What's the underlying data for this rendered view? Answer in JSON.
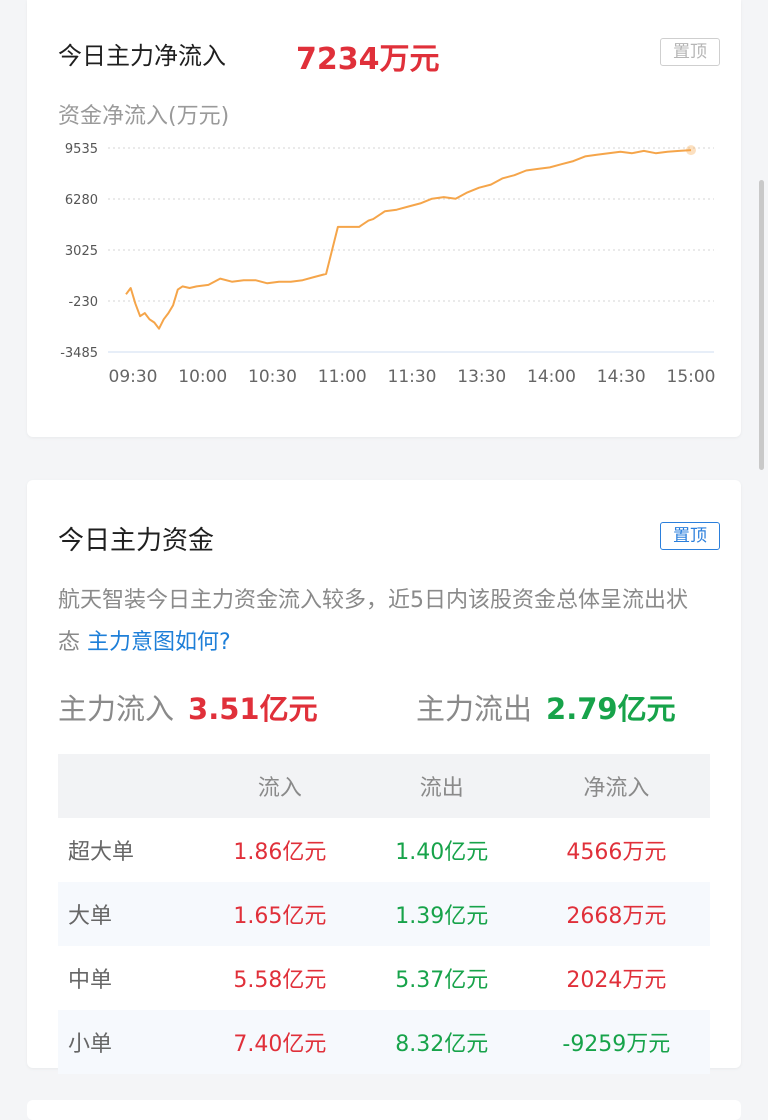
{
  "flow_card": {
    "title": "今日主力净流入",
    "value": "7234万元",
    "pin_label": "置顶",
    "chart_unit_label": "资金净流入(万元)"
  },
  "chart_data": {
    "type": "line",
    "ylim": [
      -3485,
      9535
    ],
    "yticks": [
      "9535",
      "6280",
      "3025",
      "-230",
      "-3485"
    ],
    "xticks": [
      "09:30",
      "10:00",
      "10:30",
      "11:00",
      "11:30",
      "13:30",
      "14:00",
      "14:30",
      "15:00"
    ],
    "grid": true,
    "line_color": "#f5a54a",
    "series": [
      {
        "x": [
          0,
          2,
          4,
          6,
          8,
          10,
          12,
          14,
          16,
          18,
          20,
          22,
          24,
          27,
          30,
          35,
          40,
          45,
          50,
          55,
          60,
          65,
          70,
          75,
          80,
          85,
          90,
          95,
          99,
          100,
          103,
          105,
          110,
          115,
          120,
          125,
          130,
          135,
          140,
          145,
          150,
          155,
          160,
          165,
          170,
          175,
          180,
          185,
          190,
          195,
          200,
          205,
          210,
          215,
          220,
          225,
          230,
          235,
          240
        ],
        "y": [
          200,
          600,
          -400,
          -1200,
          -1000,
          -1400,
          -1600,
          -2000,
          -1400,
          -1000,
          -500,
          500,
          700,
          600,
          700,
          800,
          1200,
          1000,
          1100,
          1100,
          900,
          1000,
          1000,
          1100,
          1300,
          1500,
          4500,
          4500,
          4500,
          4600,
          4900,
          5000,
          5500,
          5600,
          5800,
          6000,
          6300,
          6400,
          6300,
          6700,
          7000,
          7200,
          7600,
          7800,
          8100,
          8200,
          8300,
          8500,
          8700,
          9000,
          9100,
          9200,
          9300,
          9200,
          9350,
          9200,
          9300,
          9350,
          9400
        ]
      }
    ]
  },
  "funds_card": {
    "title": "今日主力资金",
    "pin_label": "置顶",
    "desc_text": "航天智装今日主力资金流入较多，近5日内该股资金总体呈流出状态",
    "desc_link": "主力意图如何?",
    "inflow_label": "主力流入",
    "inflow_value": "3.51亿元",
    "outflow_label": "主力流出",
    "outflow_value": "2.79亿元",
    "table": {
      "headers": [
        "",
        "流入",
        "流出",
        "净流入"
      ],
      "rows": [
        {
          "label": "超大单",
          "in": "1.86亿元",
          "out": "1.40亿元",
          "net": "4566万元"
        },
        {
          "label": "大单",
          "in": "1.65亿元",
          "out": "1.39亿元",
          "net": "2668万元"
        },
        {
          "label": "中单",
          "in": "5.58亿元",
          "out": "5.37亿元",
          "net": "2024万元"
        },
        {
          "label": "小单",
          "in": "7.40亿元",
          "out": "8.32亿元",
          "net": "-9259万元"
        }
      ]
    }
  },
  "colors": {
    "accent_red": "#e0303a",
    "accent_green": "#17a34a",
    "link_blue": "#1e7fd8"
  }
}
